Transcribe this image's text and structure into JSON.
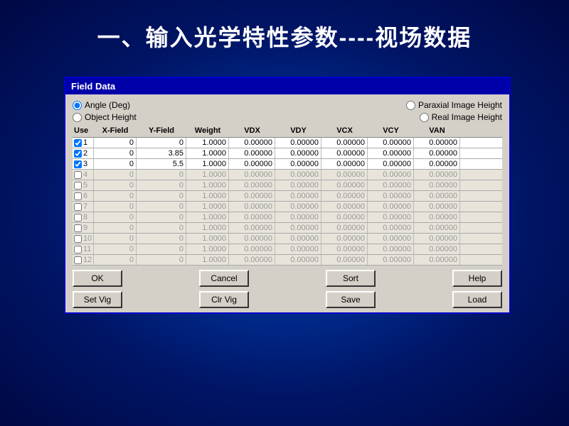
{
  "page": {
    "title": "一、输入光学特性参数----视场数据",
    "background_color": "#001a7a"
  },
  "dialog": {
    "title": "Field Data",
    "radio_options": {
      "angle_deg": "Angle (Deg)",
      "object_height": "Object Height",
      "paraxial_image_height": "Paraxial Image Height",
      "real_image_height": "Real Image Height"
    },
    "columns": [
      "Use",
      "X-Field",
      "Y-Field",
      "Weight",
      "VDX",
      "VDY",
      "VCX",
      "VCY",
      "VAN"
    ],
    "rows": [
      {
        "num": 1,
        "active": true,
        "checked": true,
        "x": "0",
        "y": "0",
        "weight": "1.0000",
        "vdx": "0.00000",
        "vdy": "0.00000",
        "vcx": "0.00000",
        "vcy": "0.00000",
        "van": "0.00000"
      },
      {
        "num": 2,
        "active": true,
        "checked": true,
        "x": "0",
        "y": "3.85",
        "weight": "1.0000",
        "vdx": "0.00000",
        "vdy": "0.00000",
        "vcx": "0.00000",
        "vcy": "0.00000",
        "van": "0.00000"
      },
      {
        "num": 3,
        "active": true,
        "checked": true,
        "x": "0",
        "y": "5.5",
        "weight": "1.0000",
        "vdx": "0.00000",
        "vdy": "0.00000",
        "vcx": "0.00000",
        "vcy": "0.00000",
        "van": "0.00000"
      },
      {
        "num": 4,
        "active": false,
        "checked": false,
        "x": "0",
        "y": "0",
        "weight": "1.0000",
        "vdx": "0.00000",
        "vdy": "0.00000",
        "vcx": "0.00000",
        "vcy": "0.00000",
        "van": "0.00000"
      },
      {
        "num": 5,
        "active": false,
        "checked": false,
        "x": "0",
        "y": "0",
        "weight": "1.0000",
        "vdx": "0.00000",
        "vdy": "0.00000",
        "vcx": "0.00000",
        "vcy": "0.00000",
        "van": "0.00000"
      },
      {
        "num": 6,
        "active": false,
        "checked": false,
        "x": "0",
        "y": "0",
        "weight": "1.0000",
        "vdx": "0.00000",
        "vdy": "0.00000",
        "vcx": "0.00000",
        "vcy": "0.00000",
        "van": "0.00000"
      },
      {
        "num": 7,
        "active": false,
        "checked": false,
        "x": "0",
        "y": "0",
        "weight": "1.0000",
        "vdx": "0.00000",
        "vdy": "0.00000",
        "vcx": "0.00000",
        "vcy": "0.00000",
        "van": "0.00000"
      },
      {
        "num": 8,
        "active": false,
        "checked": false,
        "x": "0",
        "y": "0",
        "weight": "1.0000",
        "vdx": "0.00000",
        "vdy": "0.00000",
        "vcx": "0.00000",
        "vcy": "0.00000",
        "van": "0.00000"
      },
      {
        "num": 9,
        "active": false,
        "checked": false,
        "x": "0",
        "y": "0",
        "weight": "1.0000",
        "vdx": "0.00000",
        "vdy": "0.00000",
        "vcx": "0.00000",
        "vcy": "0.00000",
        "van": "0.00000"
      },
      {
        "num": 10,
        "active": false,
        "checked": false,
        "x": "0",
        "y": "0",
        "weight": "1.0000",
        "vdx": "0.00000",
        "vdy": "0.00000",
        "vcx": "0.00000",
        "vcy": "0.00000",
        "van": "0.00000"
      },
      {
        "num": 11,
        "active": false,
        "checked": false,
        "x": "0",
        "y": "0",
        "weight": "1.0000",
        "vdx": "0.00000",
        "vdy": "0.00000",
        "vcx": "0.00000",
        "vcy": "0.00000",
        "van": "0.00000"
      },
      {
        "num": 12,
        "active": false,
        "checked": false,
        "x": "0",
        "y": "0",
        "weight": "1.0000",
        "vdx": "0.00000",
        "vdy": "0.00000",
        "vcx": "0.00000",
        "vcy": "0.00000",
        "van": "0.00000"
      }
    ],
    "buttons_row1": {
      "ok": "OK",
      "cancel": "Cancel",
      "sort": "Sort",
      "help": "Help"
    },
    "buttons_row2": {
      "set_vig": "Set Vig",
      "clr_vig": "Clr Vig",
      "save": "Save",
      "load": "Load"
    }
  }
}
